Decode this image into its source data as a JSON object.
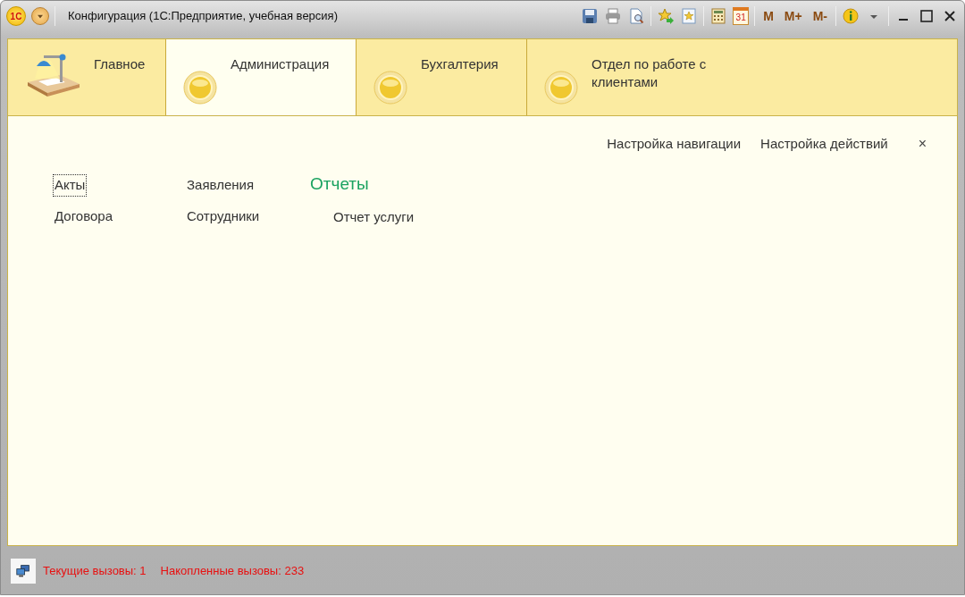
{
  "window": {
    "logo": "1С",
    "title": "Конфигурация  (1С:Предприятие, учебная версия)"
  },
  "toolbar": {
    "calendar_day": "31",
    "memory_buttons": [
      "M",
      "M+",
      "M-"
    ]
  },
  "sections": [
    {
      "kind": "home",
      "label": "Главное",
      "selected": false
    },
    {
      "kind": "section",
      "label": "Администрация",
      "selected": true
    },
    {
      "kind": "section",
      "label": "Бухгалтерия",
      "selected": false
    },
    {
      "kind": "section",
      "label": "Отдел по работе с клиентами",
      "selected": false
    }
  ],
  "panel": {
    "actions": [
      "Настройка навигации",
      "Настройка действий"
    ],
    "close": "×",
    "columns": [
      {
        "kind": "links",
        "items": [
          {
            "label": "Акты",
            "focused": true
          },
          {
            "label": "Договора",
            "focused": false
          }
        ]
      },
      {
        "kind": "links",
        "items": [
          {
            "label": "Заявления",
            "focused": false
          },
          {
            "label": "Сотрудники",
            "focused": false
          }
        ]
      },
      {
        "kind": "group",
        "title": "Отчеты",
        "items": [
          {
            "label": "Отчет услуги",
            "focused": false
          }
        ]
      }
    ]
  },
  "status_bar": [
    "Текущие вызовы: 1",
    "Накопленные вызовы: 233"
  ]
}
